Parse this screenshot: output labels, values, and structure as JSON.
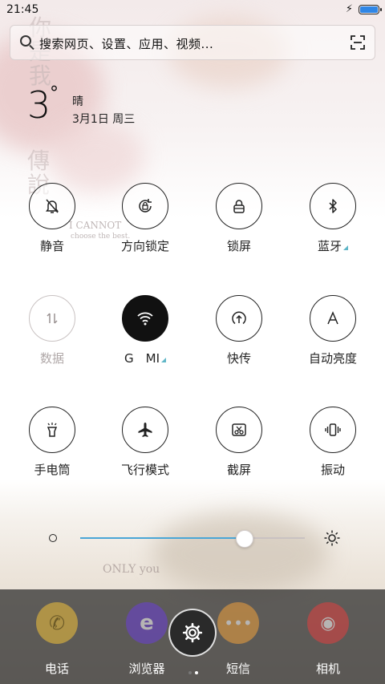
{
  "status": {
    "time": "21:45",
    "battery_level": 1.0
  },
  "search": {
    "placeholder": "搜索网页、设置、应用、视频..."
  },
  "weather": {
    "temperature": "3",
    "degree_symbol": "°",
    "condition": "晴",
    "date": "3月1日 周三"
  },
  "quick_toggles": [
    {
      "label": "静音",
      "icon": "bell-off-icon",
      "state": "off"
    },
    {
      "label": "方向锁定",
      "icon": "rotation-lock-icon",
      "state": "off"
    },
    {
      "label": "锁屏",
      "icon": "lock-icon",
      "state": "off"
    },
    {
      "label": "蓝牙",
      "icon": "bluetooth-icon",
      "state": "off",
      "expandable": true
    },
    {
      "label": "数据",
      "icon": "data-arrows-icon",
      "state": "disabled"
    },
    {
      "label": "G　MI",
      "icon": "wifi-icon",
      "state": "on",
      "expandable": true
    },
    {
      "label": "快传",
      "icon": "quick-transfer-icon",
      "state": "off"
    },
    {
      "label": "自动亮度",
      "icon": "auto-brightness-icon",
      "state": "off"
    },
    {
      "label": "手电筒",
      "icon": "flashlight-icon",
      "state": "off"
    },
    {
      "label": "飞行模式",
      "icon": "airplane-icon",
      "state": "off"
    },
    {
      "label": "截屏",
      "icon": "screenshot-icon",
      "state": "off"
    },
    {
      "label": "振动",
      "icon": "vibrate-icon",
      "state": "off"
    }
  ],
  "brightness": {
    "level": 0.73
  },
  "dock": {
    "apps": [
      {
        "name": "电话",
        "icon": "phone-icon",
        "color": "#f2c23a"
      },
      {
        "name": "浏览器",
        "icon": "browser-icon",
        "color": "#6a3fd6"
      },
      {
        "name": "短信",
        "icon": "message-icon",
        "color": "#f0a13c"
      },
      {
        "name": "相机",
        "icon": "camera-icon",
        "color": "#e04040"
      }
    ],
    "page_indicator": {
      "pages": 2,
      "current": 2
    }
  },
  "wallpaper_text": {
    "vertical_top": "你是我",
    "vertical_mid": "傳說",
    "overlay_1": "I CANNOT",
    "overlay_2": "choose the best.",
    "overlay_3": "ONLY you"
  },
  "colors": {
    "accent": "#4aa6d6",
    "wifi_on": "#111111",
    "expand_marker": "#5fb6c7"
  }
}
